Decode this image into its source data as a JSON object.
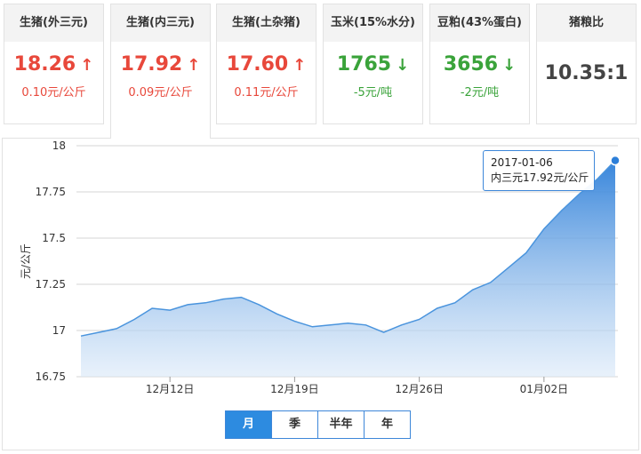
{
  "cards": [
    {
      "name": "生猪(外三元)",
      "price": "18.26",
      "direction": "up",
      "change": "0.10元/公斤"
    },
    {
      "name": "生猪(内三元)",
      "price": "17.92",
      "direction": "up",
      "change": "0.09元/公斤"
    },
    {
      "name": "生猪(土杂猪)",
      "price": "17.60",
      "direction": "up",
      "change": "0.11元/公斤"
    },
    {
      "name": "玉米(15%水分)",
      "price": "1765",
      "direction": "down",
      "change": "-5元/吨"
    },
    {
      "name": "豆粕(43%蛋白)",
      "price": "3656",
      "direction": "down",
      "change": "-2元/吨"
    },
    {
      "name": "猪粮比",
      "price": "10.35:1",
      "direction": "none",
      "change": ""
    }
  ],
  "active_card_index": 1,
  "tooltip": {
    "date": "2017-01-06",
    "text": "内三元17.92元/公斤"
  },
  "range_tabs": [
    "月",
    "季",
    "半年",
    "年"
  ],
  "active_range_index": 0,
  "chart_data": {
    "type": "area",
    "ylabel": "元/公斤",
    "ylim": [
      16.75,
      18
    ],
    "yticks": [
      "16.75",
      "17",
      "17.25",
      "17.5",
      "17.75",
      "18"
    ],
    "xticks": [
      {
        "date": "2016-12-12",
        "label": "12月12日"
      },
      {
        "date": "2016-12-19",
        "label": "12月19日"
      },
      {
        "date": "2016-12-26",
        "label": "12月26日"
      },
      {
        "date": "2017-01-02",
        "label": "01月02日"
      }
    ],
    "x_start": "2016-12-07",
    "x_end": "2017-01-06",
    "grid": true,
    "series": [
      {
        "color": "#2d8be0",
        "points": [
          [
            "2016-12-07",
            16.97
          ],
          [
            "2016-12-08",
            16.99
          ],
          [
            "2016-12-09",
            17.01
          ],
          [
            "2016-12-10",
            17.06
          ],
          [
            "2016-12-11",
            17.12
          ],
          [
            "2016-12-12",
            17.11
          ],
          [
            "2016-12-13",
            17.14
          ],
          [
            "2016-12-14",
            17.15
          ],
          [
            "2016-12-15",
            17.17
          ],
          [
            "2016-12-16",
            17.18
          ],
          [
            "2016-12-17",
            17.14
          ],
          [
            "2016-12-18",
            17.09
          ],
          [
            "2016-12-19",
            17.05
          ],
          [
            "2016-12-20",
            17.02
          ],
          [
            "2016-12-21",
            17.03
          ],
          [
            "2016-12-22",
            17.04
          ],
          [
            "2016-12-23",
            17.03
          ],
          [
            "2016-12-24",
            16.99
          ],
          [
            "2016-12-25",
            17.03
          ],
          [
            "2016-12-26",
            17.06
          ],
          [
            "2016-12-27",
            17.12
          ],
          [
            "2016-12-28",
            17.15
          ],
          [
            "2016-12-29",
            17.22
          ],
          [
            "2016-12-30",
            17.26
          ],
          [
            "2016-12-31",
            17.34
          ],
          [
            "2017-01-01",
            17.42
          ],
          [
            "2017-01-02",
            17.55
          ],
          [
            "2017-01-03",
            17.65
          ],
          [
            "2017-01-04",
            17.74
          ],
          [
            "2017-01-05",
            17.82
          ],
          [
            "2017-01-06",
            17.92
          ]
        ]
      }
    ]
  }
}
